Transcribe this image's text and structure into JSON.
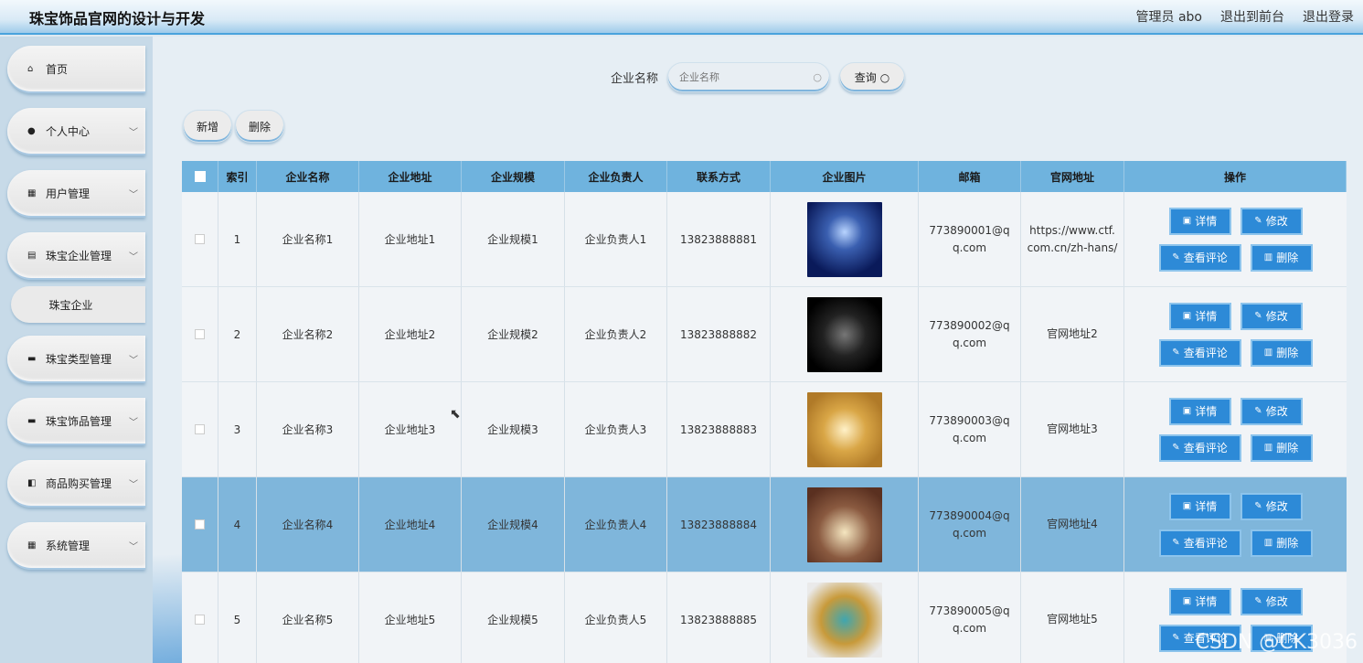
{
  "header": {
    "title": "珠宝饰品官网的设计与开发",
    "admin": "管理员 abo",
    "to_front": "退出到前台",
    "logout": "退出登录"
  },
  "sidebar": {
    "items": [
      {
        "label": "首页",
        "icon": "home-icon"
      },
      {
        "label": "个人中心",
        "icon": "user-icon"
      },
      {
        "label": "用户管理",
        "icon": "grid-icon"
      },
      {
        "label": "珠宝企业管理",
        "icon": "doc-icon"
      },
      {
        "label": "珠宝类型管理",
        "icon": "monitor-icon"
      },
      {
        "label": "珠宝饰品管理",
        "icon": "chat-icon"
      },
      {
        "label": "商品购买管理",
        "icon": "bag-icon"
      },
      {
        "label": "系统管理",
        "icon": "grid-icon"
      }
    ],
    "sub_item": "珠宝企业"
  },
  "search": {
    "label": "企业名称",
    "placeholder": "企业名称",
    "query_label": "查询"
  },
  "toolbar": {
    "add_label": "新增",
    "delete_label": "删除"
  },
  "table": {
    "headers": [
      "索引",
      "企业名称",
      "企业地址",
      "企业规模",
      "企业负责人",
      "联系方式",
      "企业图片",
      "邮箱",
      "官网地址",
      "操作"
    ],
    "rows": [
      {
        "index": "1",
        "name": "企业名称1",
        "address": "企业地址1",
        "scale": "企业规模1",
        "leader": "企业负责人1",
        "phone": "13823888881",
        "email": "773890001@qq.com",
        "site": "https://www.ctf.com.cn/zh-hans/"
      },
      {
        "index": "2",
        "name": "企业名称2",
        "address": "企业地址2",
        "scale": "企业规模2",
        "leader": "企业负责人2",
        "phone": "13823888882",
        "email": "773890002@qq.com",
        "site": "官网地址2"
      },
      {
        "index": "3",
        "name": "企业名称3",
        "address": "企业地址3",
        "scale": "企业规模3",
        "leader": "企业负责人3",
        "phone": "13823888883",
        "email": "773890003@qq.com",
        "site": "官网地址3"
      },
      {
        "index": "4",
        "name": "企业名称4",
        "address": "企业地址4",
        "scale": "企业规模4",
        "leader": "企业负责人4",
        "phone": "13823888884",
        "email": "773890004@qq.com",
        "site": "官网地址4"
      },
      {
        "index": "5",
        "name": "企业名称5",
        "address": "企业地址5",
        "scale": "企业规模5",
        "leader": "企业负责人5",
        "phone": "13823888885",
        "email": "773890005@qq.com",
        "site": "官网地址5"
      }
    ],
    "ops": {
      "detail": "详情",
      "edit": "修改",
      "review": "查看评论",
      "delete": "删除"
    }
  },
  "watermark": "CSDN @CK3036",
  "colors": {
    "header_accent": "#4aa3dd",
    "table_header": "#6fb3de",
    "op_button": "#2d8ad7",
    "row_highlight": "#7fb6db"
  }
}
